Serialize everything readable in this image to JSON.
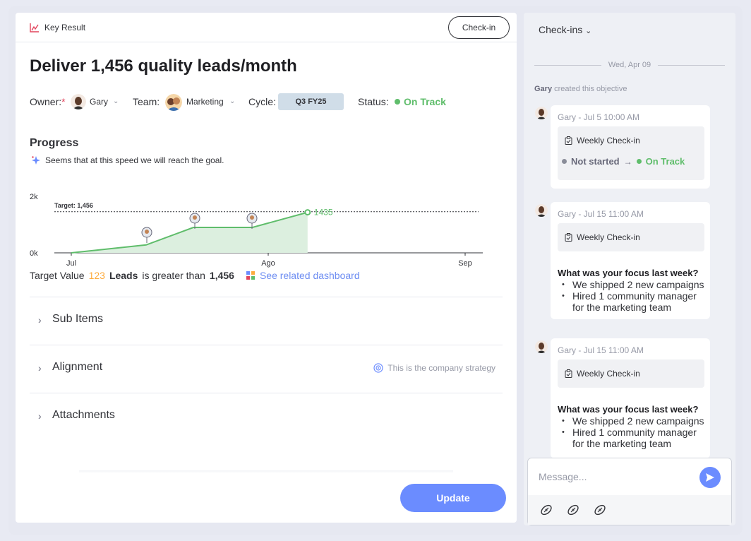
{
  "header": {
    "label": "Key Result",
    "checkin_button": "Check-in"
  },
  "title": "Deliver 1,456 quality leads/month",
  "meta": {
    "owner_label": "Owner:",
    "owner_required": "*",
    "owner_name": "Gary",
    "team_label": "Team:",
    "team_name": "Marketing",
    "cycle_label": "Cycle:",
    "cycle_value": "Q3 FY25",
    "status_label": "Status:",
    "status_value": "On Track",
    "status_color": "#5fbd6b"
  },
  "progress": {
    "title": "Progress",
    "hint": "Seems that at this speed we will reach the goal."
  },
  "chart_data": {
    "type": "area",
    "target_label": "Target: 1,456",
    "target": 1456,
    "y_ticks": [
      "2k",
      "0k"
    ],
    "ylim": [
      0,
      2000
    ],
    "x_ticks": [
      "Jul",
      "Ago",
      "Sep"
    ],
    "points": [
      {
        "x": 0.0,
        "y": 0
      },
      {
        "x": 0.38,
        "y": 280
      },
      {
        "x": 0.62,
        "y": 900
      },
      {
        "x": 0.92,
        "y": 900
      },
      {
        "x": 1.2,
        "y": 1150
      },
      {
        "x": 1.2,
        "y": 1435
      }
    ],
    "last_value_label": "1435",
    "line_color": "#5fbd6b",
    "fill_color": "#dcefdf",
    "checkin_markers": 3
  },
  "target_value": {
    "label": "Target Value",
    "number": "123",
    "unit": "Leads",
    "text": "is greater than",
    "threshold": "1,456",
    "dashboard_link": "See related dashboard"
  },
  "sections": [
    {
      "label": "Sub Items",
      "note": ""
    },
    {
      "label": "Alignment",
      "note": "This is the company strategy"
    },
    {
      "label": "Attachments",
      "note": ""
    }
  ],
  "update_button": "Update",
  "checkins": {
    "title": "Check-ins",
    "date": "Wed, Apr 09",
    "created_user": "Gary",
    "created_text": "created this objective",
    "cards": [
      {
        "meta": "Gary - Jul 5 10:00 AM",
        "type": "Weekly Check-in",
        "from_status": "Not started",
        "to_status": "On Track"
      },
      {
        "meta": "Gary - Jul 15 11:00 AM",
        "type": "Weekly Check-in",
        "question": "What was your focus last week?",
        "answers": [
          "We shipped 2 new campaigns",
          "Hired 1 community manager for the marketing team"
        ]
      },
      {
        "meta": "Gary - Jul 15 11:00 AM",
        "type": "Weekly Check-in",
        "question": "What was your focus last week?",
        "answers": [
          "We shipped 2 new campaigns",
          "Hired 1 community manager for the marketing team"
        ]
      }
    ]
  },
  "message": {
    "placeholder": "Message..."
  }
}
